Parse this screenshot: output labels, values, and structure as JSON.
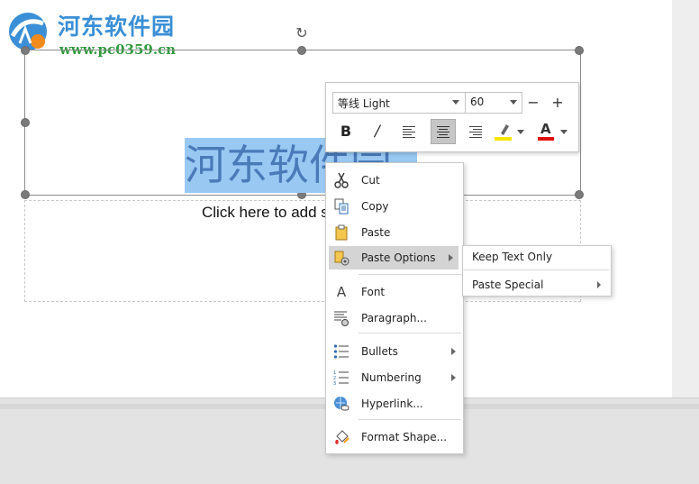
{
  "watermark": {
    "title": "河东软件园",
    "url": "www.pc0359.cn"
  },
  "slide": {
    "title_text": "河东软件园",
    "subtitle_placeholder": "Click here to add subtitle"
  },
  "mini_toolbar": {
    "font_name": "等线 Light",
    "font_size": "60",
    "decrease_label": "−",
    "increase_label": "+",
    "bold_label": "B",
    "italic_label": "/",
    "font_color_label": "A",
    "highlight_color": "#f5e600",
    "font_color": "#e01010"
  },
  "context_menu": {
    "items": [
      {
        "label": "Cut",
        "icon": "scissors-icon"
      },
      {
        "label": "Copy",
        "icon": "copy-icon"
      },
      {
        "label": "Paste",
        "icon": "clipboard-icon"
      },
      {
        "label": "Paste Options",
        "icon": "paste-options-icon",
        "submenu": true
      },
      {
        "label": "Font",
        "icon": "font-icon"
      },
      {
        "label": "Paragraph...",
        "icon": "paragraph-icon"
      },
      {
        "label": "Bullets",
        "icon": "bullets-icon",
        "submenu": true
      },
      {
        "label": "Numbering",
        "icon": "numbering-icon",
        "submenu": true
      },
      {
        "label": "Hyperlink...",
        "icon": "hyperlink-icon"
      },
      {
        "label": "Format Shape...",
        "icon": "format-shape-icon"
      }
    ]
  },
  "submenu": {
    "items": [
      {
        "label": "Keep Text Only"
      },
      {
        "label": "Paste Special",
        "submenu": true
      }
    ]
  },
  "colors": {
    "selection": "#99c9f3",
    "hover": "#d4d4d4",
    "accent_blue": "#3a8fd6"
  }
}
